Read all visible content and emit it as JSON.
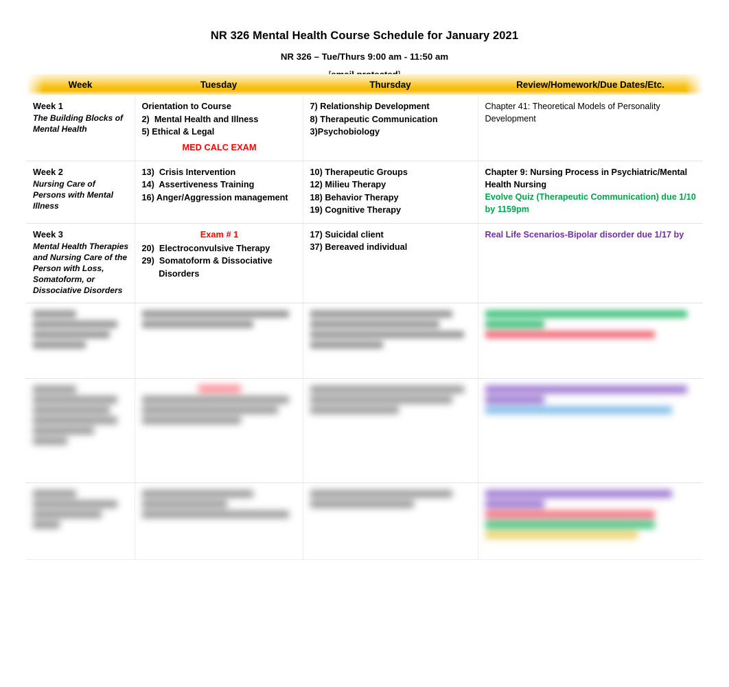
{
  "document": {
    "title": "NR 326 Mental Health Course Schedule for January 2021",
    "subtitle": "NR 326 – Tue/Thurs 9:00 am - 11:50 am",
    "email_open_bracket": "[",
    "email_text": "email protected",
    "email_close_bracket": "]"
  },
  "colors": {
    "header_band_gold": "#f7c318",
    "header_band_light": "#fdf4d8",
    "exam_red": "#ff0000",
    "due_green": "#00a44b",
    "due_purple": "#7030a0",
    "text_black": "#000000",
    "cell_border": "#e3e3e3"
  },
  "table": {
    "columns": [
      {
        "key": "week",
        "label": "Week"
      },
      {
        "key": "tue",
        "label": "Tuesday"
      },
      {
        "key": "thu",
        "label": "Thursday"
      },
      {
        "key": "review",
        "label": "Review/Homework/Due Dates/Etc."
      }
    ],
    "rows": [
      {
        "redacted": false,
        "week_name": "Week 1",
        "week_desc": "The Building Blocks of Mental Health",
        "tuesday": [
          "Orientation to Course",
          "2)  Mental Health and Illness",
          "5) Ethical & Legal"
        ],
        "tuesday_center_red": "MED CALC EXAM",
        "tuesday_exam_banner": "",
        "thursday": [
          "7) Relationship Development",
          "8) Therapeutic Communication",
          "3)Psychobiology"
        ],
        "review": [
          {
            "text": "Chapter 41: Theoretical Models of Personality Development",
            "style": "plain"
          }
        ]
      },
      {
        "redacted": false,
        "week_name": "Week 2",
        "week_desc": "Nursing Care of Persons with Mental Illness",
        "tuesday": [
          "13)  Crisis Intervention",
          "14)  Assertiveness Training",
          "16) Anger/Aggression management"
        ],
        "tuesday_center_red": "",
        "tuesday_exam_banner": "",
        "thursday": [
          "10) Therapeutic Groups",
          "12) Milieu Therapy",
          "18) Behavior Therapy",
          "19) Cognitive Therapy"
        ],
        "review": [
          {
            "text": "Chapter 9: Nursing Process in Psychiatric/Mental Health Nursing",
            "style": "bold"
          },
          {
            "text": "Evolve Quiz (Therapeutic Communication) due 1/10 by 1159pm",
            "style": "green"
          }
        ]
      },
      {
        "redacted": false,
        "week_name": "Week 3",
        "week_desc": "Mental Health Therapies and Nursing Care of the Person with Loss, Somatoform, or Dissociative Disorders",
        "tuesday": [
          "20)  Electroconvulsive Therapy",
          "29)  Somatoform & Dissociative\n       Disorders"
        ],
        "tuesday_center_red": "",
        "tuesday_exam_banner": "Exam # 1",
        "thursday": [
          "17) Suicidal client",
          "37) Bereaved individual"
        ],
        "review": [
          {
            "text": "Real Life Scenarios-Bipolar disorder due 1/17 by",
            "style": "purple"
          }
        ]
      },
      {
        "redacted": true,
        "week_name": "[redacted]",
        "week_desc": "[redacted]",
        "tuesday": [
          "[redacted]",
          "[redacted]"
        ],
        "tuesday_center_red": "",
        "tuesday_exam_banner": "",
        "thursday": [
          "[redacted]",
          "[redacted]",
          "[redacted]"
        ],
        "review": [
          {
            "text": "[redacted]",
            "style": "green"
          },
          {
            "text": "[redacted]",
            "style": "red"
          }
        ]
      },
      {
        "redacted": true,
        "week_name": "[redacted]",
        "week_desc": "[redacted]",
        "tuesday": [
          "[redacted]",
          "[redacted]",
          "[redacted]"
        ],
        "tuesday_center_red": "",
        "tuesday_exam_banner": "[redacted exam label]",
        "thursday": [
          "[redacted]",
          "[redacted]"
        ],
        "review": [
          {
            "text": "[redacted]",
            "style": "purple"
          },
          {
            "text": "[redacted]",
            "style": "blue"
          }
        ]
      },
      {
        "redacted": true,
        "week_name": "[redacted]",
        "week_desc": "[redacted]",
        "tuesday": [
          "[redacted]",
          "[redacted]",
          "[redacted]"
        ],
        "tuesday_center_red": "",
        "tuesday_exam_banner": "",
        "thursday": [
          "[redacted]",
          "[redacted]"
        ],
        "review": [
          {
            "text": "[redacted]",
            "style": "purple"
          },
          {
            "text": "[redacted]",
            "style": "red"
          },
          {
            "text": "[redacted]",
            "style": "green"
          },
          {
            "text": "[redacted]",
            "style": "yellow"
          }
        ]
      }
    ]
  }
}
